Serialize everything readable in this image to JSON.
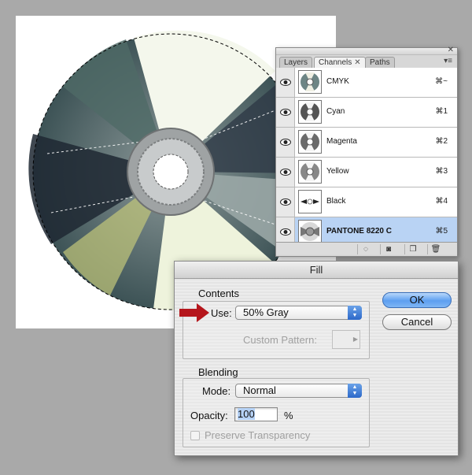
{
  "panel": {
    "tabs": [
      {
        "label": "Layers"
      },
      {
        "label": "Channels",
        "close": "✕"
      },
      {
        "label": "Paths"
      }
    ],
    "close_glyph": "✕",
    "menu_glyph": "▾≡",
    "channels": [
      {
        "name": "CMYK",
        "shortcut": "⌘~",
        "visible": true,
        "selected": false
      },
      {
        "name": "Cyan",
        "shortcut": "⌘1",
        "visible": true,
        "selected": false
      },
      {
        "name": "Magenta",
        "shortcut": "⌘2",
        "visible": true,
        "selected": false
      },
      {
        "name": "Yellow",
        "shortcut": "⌘3",
        "visible": true,
        "selected": false
      },
      {
        "name": "Black",
        "shortcut": "⌘4",
        "visible": true,
        "selected": false
      },
      {
        "name": "PANTONE 8220 C",
        "shortcut": "⌘5",
        "visible": true,
        "selected": true
      }
    ],
    "footer_icons": [
      "load-selection-icon",
      "save-selection-icon",
      "new-channel-icon",
      "trash-icon"
    ],
    "footer_glyphs": [
      "◌",
      "◙",
      "❐",
      "🗑"
    ],
    "selected_color": "#b9d3f4"
  },
  "dialog": {
    "title": "Fill",
    "contents_label": "Contents",
    "use_label": "Use:",
    "use_value": "50% Gray",
    "custom_pattern_label": "Custom Pattern:",
    "blending_label": "Blending",
    "mode_label": "Mode:",
    "mode_value": "Normal",
    "opacity_label": "Opacity:",
    "opacity_value": "100",
    "percent": "%",
    "preserve_label": "Preserve Transparency",
    "ok_label": "OK",
    "cancel_label": "Cancel",
    "accent_color": "#5d9ff0",
    "arrow_color": "#b5161c"
  }
}
